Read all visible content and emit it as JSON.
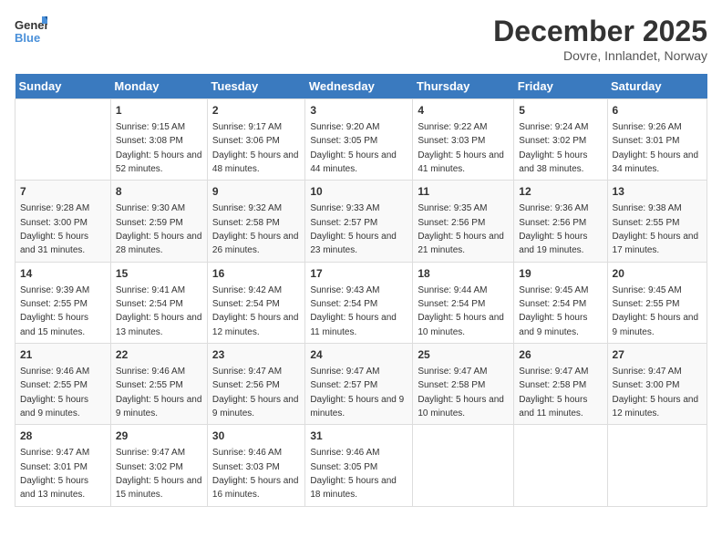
{
  "logo": {
    "text_general": "General",
    "text_blue": "Blue"
  },
  "title": "December 2025",
  "subtitle": "Dovre, Innlandet, Norway",
  "days_header": [
    "Sunday",
    "Monday",
    "Tuesday",
    "Wednesday",
    "Thursday",
    "Friday",
    "Saturday"
  ],
  "weeks": [
    [
      {
        "day": "",
        "sunrise": "",
        "sunset": "",
        "daylight": ""
      },
      {
        "day": "1",
        "sunrise": "Sunrise: 9:15 AM",
        "sunset": "Sunset: 3:08 PM",
        "daylight": "Daylight: 5 hours and 52 minutes."
      },
      {
        "day": "2",
        "sunrise": "Sunrise: 9:17 AM",
        "sunset": "Sunset: 3:06 PM",
        "daylight": "Daylight: 5 hours and 48 minutes."
      },
      {
        "day": "3",
        "sunrise": "Sunrise: 9:20 AM",
        "sunset": "Sunset: 3:05 PM",
        "daylight": "Daylight: 5 hours and 44 minutes."
      },
      {
        "day": "4",
        "sunrise": "Sunrise: 9:22 AM",
        "sunset": "Sunset: 3:03 PM",
        "daylight": "Daylight: 5 hours and 41 minutes."
      },
      {
        "day": "5",
        "sunrise": "Sunrise: 9:24 AM",
        "sunset": "Sunset: 3:02 PM",
        "daylight": "Daylight: 5 hours and 38 minutes."
      },
      {
        "day": "6",
        "sunrise": "Sunrise: 9:26 AM",
        "sunset": "Sunset: 3:01 PM",
        "daylight": "Daylight: 5 hours and 34 minutes."
      }
    ],
    [
      {
        "day": "7",
        "sunrise": "Sunrise: 9:28 AM",
        "sunset": "Sunset: 3:00 PM",
        "daylight": "Daylight: 5 hours and 31 minutes."
      },
      {
        "day": "8",
        "sunrise": "Sunrise: 9:30 AM",
        "sunset": "Sunset: 2:59 PM",
        "daylight": "Daylight: 5 hours and 28 minutes."
      },
      {
        "day": "9",
        "sunrise": "Sunrise: 9:32 AM",
        "sunset": "Sunset: 2:58 PM",
        "daylight": "Daylight: 5 hours and 26 minutes."
      },
      {
        "day": "10",
        "sunrise": "Sunrise: 9:33 AM",
        "sunset": "Sunset: 2:57 PM",
        "daylight": "Daylight: 5 hours and 23 minutes."
      },
      {
        "day": "11",
        "sunrise": "Sunrise: 9:35 AM",
        "sunset": "Sunset: 2:56 PM",
        "daylight": "Daylight: 5 hours and 21 minutes."
      },
      {
        "day": "12",
        "sunrise": "Sunrise: 9:36 AM",
        "sunset": "Sunset: 2:56 PM",
        "daylight": "Daylight: 5 hours and 19 minutes."
      },
      {
        "day": "13",
        "sunrise": "Sunrise: 9:38 AM",
        "sunset": "Sunset: 2:55 PM",
        "daylight": "Daylight: 5 hours and 17 minutes."
      }
    ],
    [
      {
        "day": "14",
        "sunrise": "Sunrise: 9:39 AM",
        "sunset": "Sunset: 2:55 PM",
        "daylight": "Daylight: 5 hours and 15 minutes."
      },
      {
        "day": "15",
        "sunrise": "Sunrise: 9:41 AM",
        "sunset": "Sunset: 2:54 PM",
        "daylight": "Daylight: 5 hours and 13 minutes."
      },
      {
        "day": "16",
        "sunrise": "Sunrise: 9:42 AM",
        "sunset": "Sunset: 2:54 PM",
        "daylight": "Daylight: 5 hours and 12 minutes."
      },
      {
        "day": "17",
        "sunrise": "Sunrise: 9:43 AM",
        "sunset": "Sunset: 2:54 PM",
        "daylight": "Daylight: 5 hours and 11 minutes."
      },
      {
        "day": "18",
        "sunrise": "Sunrise: 9:44 AM",
        "sunset": "Sunset: 2:54 PM",
        "daylight": "Daylight: 5 hours and 10 minutes."
      },
      {
        "day": "19",
        "sunrise": "Sunrise: 9:45 AM",
        "sunset": "Sunset: 2:54 PM",
        "daylight": "Daylight: 5 hours and 9 minutes."
      },
      {
        "day": "20",
        "sunrise": "Sunrise: 9:45 AM",
        "sunset": "Sunset: 2:55 PM",
        "daylight": "Daylight: 5 hours and 9 minutes."
      }
    ],
    [
      {
        "day": "21",
        "sunrise": "Sunrise: 9:46 AM",
        "sunset": "Sunset: 2:55 PM",
        "daylight": "Daylight: 5 hours and 9 minutes."
      },
      {
        "day": "22",
        "sunrise": "Sunrise: 9:46 AM",
        "sunset": "Sunset: 2:55 PM",
        "daylight": "Daylight: 5 hours and 9 minutes."
      },
      {
        "day": "23",
        "sunrise": "Sunrise: 9:47 AM",
        "sunset": "Sunset: 2:56 PM",
        "daylight": "Daylight: 5 hours and 9 minutes."
      },
      {
        "day": "24",
        "sunrise": "Sunrise: 9:47 AM",
        "sunset": "Sunset: 2:57 PM",
        "daylight": "Daylight: 5 hours and 9 minutes."
      },
      {
        "day": "25",
        "sunrise": "Sunrise: 9:47 AM",
        "sunset": "Sunset: 2:58 PM",
        "daylight": "Daylight: 5 hours and 10 minutes."
      },
      {
        "day": "26",
        "sunrise": "Sunrise: 9:47 AM",
        "sunset": "Sunset: 2:58 PM",
        "daylight": "Daylight: 5 hours and 11 minutes."
      },
      {
        "day": "27",
        "sunrise": "Sunrise: 9:47 AM",
        "sunset": "Sunset: 3:00 PM",
        "daylight": "Daylight: 5 hours and 12 minutes."
      }
    ],
    [
      {
        "day": "28",
        "sunrise": "Sunrise: 9:47 AM",
        "sunset": "Sunset: 3:01 PM",
        "daylight": "Daylight: 5 hours and 13 minutes."
      },
      {
        "day": "29",
        "sunrise": "Sunrise: 9:47 AM",
        "sunset": "Sunset: 3:02 PM",
        "daylight": "Daylight: 5 hours and 15 minutes."
      },
      {
        "day": "30",
        "sunrise": "Sunrise: 9:46 AM",
        "sunset": "Sunset: 3:03 PM",
        "daylight": "Daylight: 5 hours and 16 minutes."
      },
      {
        "day": "31",
        "sunrise": "Sunrise: 9:46 AM",
        "sunset": "Sunset: 3:05 PM",
        "daylight": "Daylight: 5 hours and 18 minutes."
      },
      {
        "day": "",
        "sunrise": "",
        "sunset": "",
        "daylight": ""
      },
      {
        "day": "",
        "sunrise": "",
        "sunset": "",
        "daylight": ""
      },
      {
        "day": "",
        "sunrise": "",
        "sunset": "",
        "daylight": ""
      }
    ]
  ]
}
